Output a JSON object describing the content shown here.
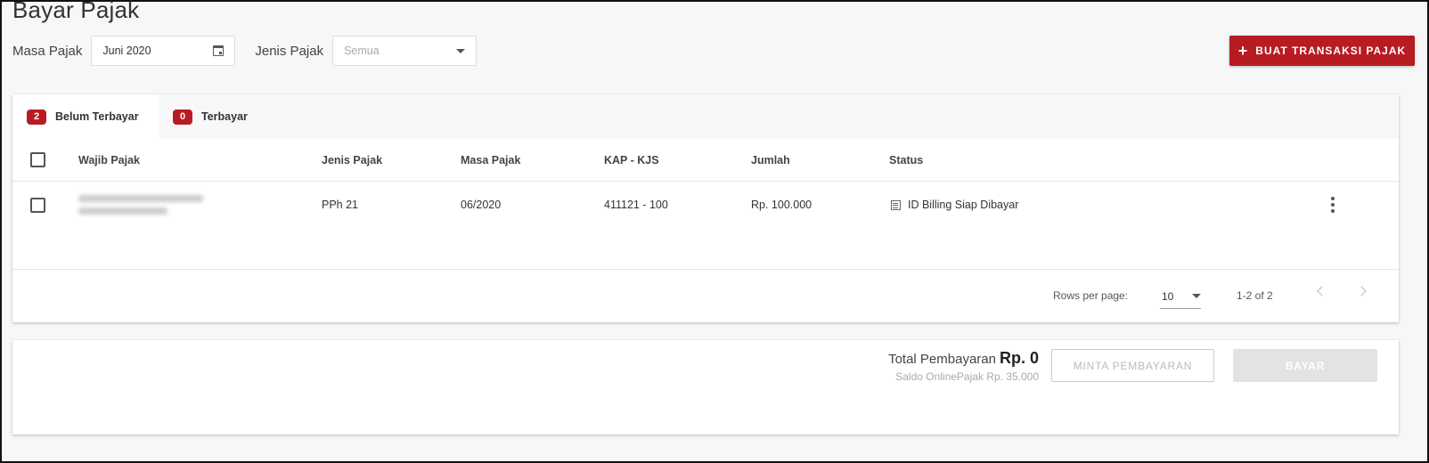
{
  "page": {
    "title": "Bayar Pajak"
  },
  "filters": {
    "masa_pajak_label": "Masa Pajak",
    "masa_pajak_value": "Juni 2020",
    "jenis_pajak_label": "Jenis Pajak",
    "jenis_pajak_placeholder": "Semua"
  },
  "actions": {
    "create_label": "BUAT TRANSAKSI PAJAK",
    "create_icon": "plus-icon"
  },
  "tabs": [
    {
      "count": "2",
      "label": "Belum Terbayar",
      "active": true
    },
    {
      "count": "0",
      "label": "Terbayar",
      "active": false
    }
  ],
  "table": {
    "headers": [
      "Wajib Pajak",
      "Jenis Pajak",
      "Masa Pajak",
      "KAP - KJS",
      "Jumlah",
      "Status"
    ],
    "rows": [
      {
        "jenis_pajak": "PPh 21",
        "masa_pajak": "06/2020",
        "kap_kjs": "411121 - 100",
        "jumlah": "Rp. 100.000",
        "status": "ID Billing Siap Dibayar",
        "status_icon": "list-icon"
      }
    ]
  },
  "pagination": {
    "rows_per_page_label": "Rows per page:",
    "rows_per_page_value": "10",
    "range_text": "1-2 of 2"
  },
  "payment": {
    "total_label": "Total Pembayaran",
    "total_amount": "Rp. 0",
    "saldo_text": "Saldo OnlinePajak Rp. 35.000",
    "minta_label": "MINTA PEMBAYARAN",
    "bayar_label": "BAYAR"
  },
  "colors": {
    "accent": "#b71c22",
    "disabled_button": "#e3e3e3"
  }
}
